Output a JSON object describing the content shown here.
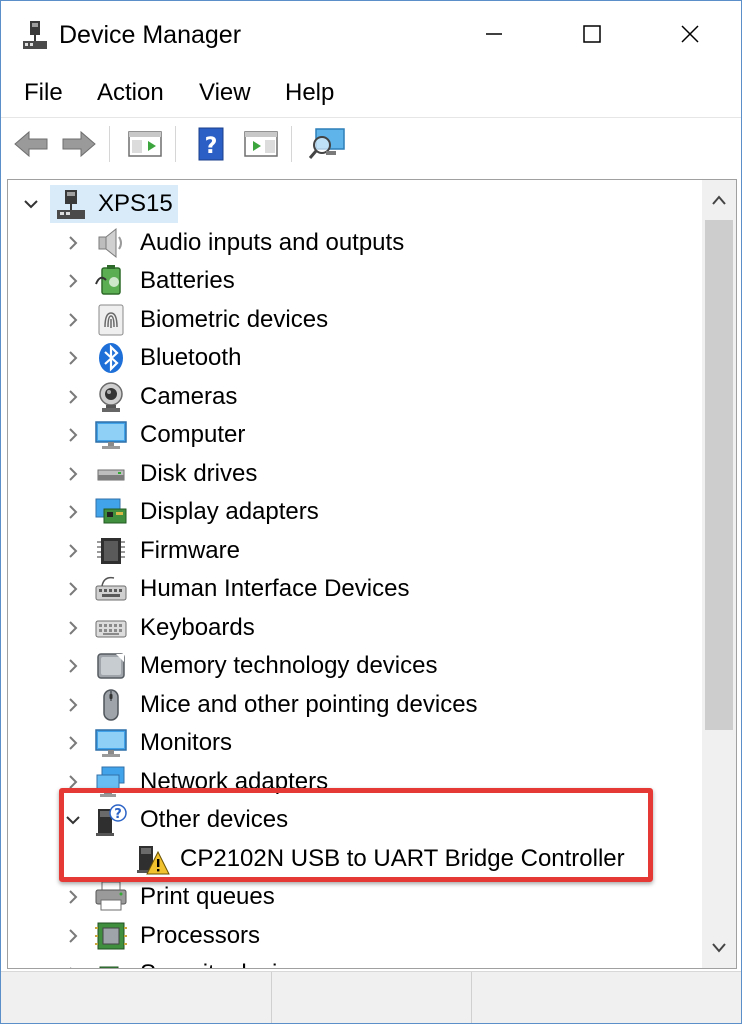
{
  "window": {
    "title": "Device Manager"
  },
  "menu": {
    "file": "File",
    "action": "Action",
    "view": "View",
    "help": "Help"
  },
  "toolbar": {
    "icons": [
      "back-arrow-icon",
      "forward-arrow-icon",
      "show-hide-console-tree-icon",
      "help-icon",
      "action-pane-icon",
      "scan-hardware-icon"
    ]
  },
  "tree": {
    "root": {
      "label": "XPS15",
      "expanded": true
    },
    "categories": [
      {
        "label": "Audio inputs and outputs",
        "icon": "speaker-icon"
      },
      {
        "label": "Batteries",
        "icon": "battery-icon"
      },
      {
        "label": "Biometric devices",
        "icon": "fingerprint-icon"
      },
      {
        "label": "Bluetooth",
        "icon": "bluetooth-icon"
      },
      {
        "label": "Cameras",
        "icon": "camera-icon"
      },
      {
        "label": "Computer",
        "icon": "computer-icon"
      },
      {
        "label": "Disk drives",
        "icon": "disk-drive-icon"
      },
      {
        "label": "Display adapters",
        "icon": "display-adapter-icon"
      },
      {
        "label": "Firmware",
        "icon": "chip-icon"
      },
      {
        "label": "Human Interface Devices",
        "icon": "hid-icon"
      },
      {
        "label": "Keyboards",
        "icon": "keyboard-icon"
      },
      {
        "label": "Memory technology devices",
        "icon": "memory-card-icon"
      },
      {
        "label": "Mice and other pointing devices",
        "icon": "mouse-icon"
      },
      {
        "label": "Monitors",
        "icon": "monitor-icon"
      },
      {
        "label": "Network adapters",
        "icon": "network-adapter-icon"
      },
      {
        "label": "Other devices",
        "icon": "unknown-device-icon",
        "expanded": true
      },
      {
        "label": "CP2102N USB to UART Bridge Controller",
        "icon": "warning-device-icon",
        "child": true
      },
      {
        "label": "Print queues",
        "icon": "printer-icon"
      },
      {
        "label": "Processors",
        "icon": "processor-icon"
      },
      {
        "label": "Security devices",
        "icon": "security-device-icon"
      }
    ]
  },
  "colors": {
    "highlight_box": "#e53935",
    "selection": "#d9ebf9",
    "accent_blue": "#1e88e5"
  }
}
